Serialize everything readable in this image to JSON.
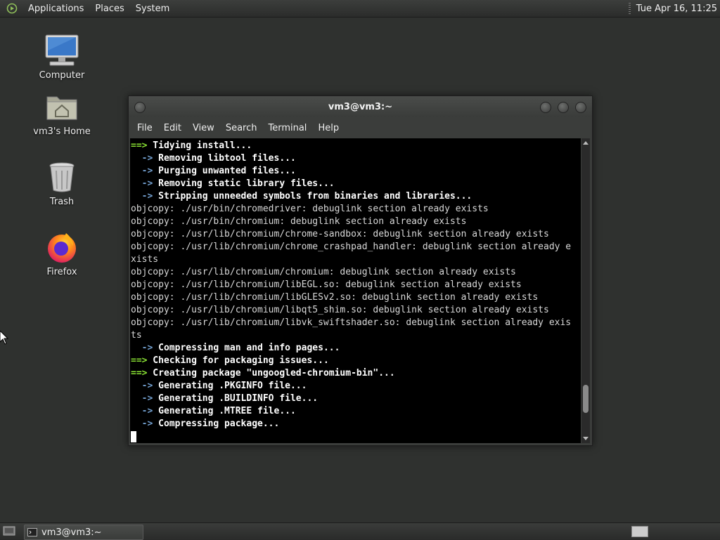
{
  "top_panel": {
    "menus": [
      "Applications",
      "Places",
      "System"
    ],
    "clock": "Tue Apr 16, 11:25"
  },
  "desktop": {
    "icons": [
      {
        "label": "Computer",
        "icon": "computer-icon"
      },
      {
        "label": "vm3's Home",
        "icon": "home-folder-icon"
      },
      {
        "label": "Trash",
        "icon": "trash-icon"
      },
      {
        "label": "Firefox",
        "icon": "firefox-icon"
      }
    ]
  },
  "terminal": {
    "title": "vm3@vm3:~",
    "menus": [
      "File",
      "Edit",
      "View",
      "Search",
      "Terminal",
      "Help"
    ],
    "lines": [
      {
        "type": "step",
        "arrow": "==>",
        "text": "Tidying install..."
      },
      {
        "type": "sub",
        "arrow": "  ->",
        "text": "Removing libtool files..."
      },
      {
        "type": "sub",
        "arrow": "  ->",
        "text": "Purging unwanted files..."
      },
      {
        "type": "sub",
        "arrow": "  ->",
        "text": "Removing static library files..."
      },
      {
        "type": "sub",
        "arrow": "  ->",
        "text": "Stripping unneeded symbols from binaries and libraries..."
      },
      {
        "type": "plain",
        "text": "objcopy: ./usr/bin/chromedriver: debuglink section already exists"
      },
      {
        "type": "plain",
        "text": "objcopy: ./usr/bin/chromium: debuglink section already exists"
      },
      {
        "type": "plain",
        "text": "objcopy: ./usr/lib/chromium/chrome-sandbox: debuglink section already exists"
      },
      {
        "type": "plain",
        "text": "objcopy: ./usr/lib/chromium/chrome_crashpad_handler: debuglink section already e"
      },
      {
        "type": "plain",
        "text": "xists"
      },
      {
        "type": "plain",
        "text": "objcopy: ./usr/lib/chromium/chromium: debuglink section already exists"
      },
      {
        "type": "plain",
        "text": "objcopy: ./usr/lib/chromium/libEGL.so: debuglink section already exists"
      },
      {
        "type": "plain",
        "text": "objcopy: ./usr/lib/chromium/libGLESv2.so: debuglink section already exists"
      },
      {
        "type": "plain",
        "text": "objcopy: ./usr/lib/chromium/libqt5_shim.so: debuglink section already exists"
      },
      {
        "type": "plain",
        "text": "objcopy: ./usr/lib/chromium/libvk_swiftshader.so: debuglink section already exis"
      },
      {
        "type": "plain",
        "text": "ts"
      },
      {
        "type": "sub",
        "arrow": "  ->",
        "text": "Compressing man and info pages..."
      },
      {
        "type": "step",
        "arrow": "==>",
        "text": "Checking for packaging issues..."
      },
      {
        "type": "step",
        "arrow": "==>",
        "text": "Creating package \"ungoogled-chromium-bin\"..."
      },
      {
        "type": "sub",
        "arrow": "  ->",
        "text": "Generating .PKGINFO file..."
      },
      {
        "type": "sub",
        "arrow": "  ->",
        "text": "Generating .BUILDINFO file..."
      },
      {
        "type": "sub",
        "arrow": "  ->",
        "text": "Generating .MTREE file..."
      },
      {
        "type": "sub",
        "arrow": "  ->",
        "text": "Compressing package..."
      },
      {
        "type": "cursor"
      }
    ],
    "scroll_position_fraction": 0.92
  },
  "bottom_panel": {
    "task_label": "vm3@vm3:~"
  }
}
